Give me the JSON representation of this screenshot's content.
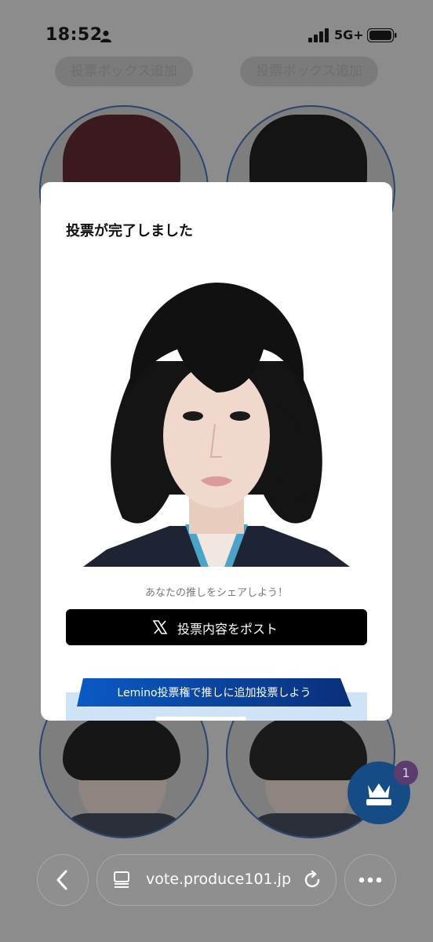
{
  "status_bar": {
    "time": "18:52",
    "network": "5G+"
  },
  "background": {
    "vote_box_label": "投票ボックス追加"
  },
  "modal": {
    "title": "投票が完了しました",
    "share_prompt": "あなたの推しをシェアしよう！",
    "post_button": "投票内容をポスト",
    "promo_banner": "Lemino投票権で推しに追加投票しよう"
  },
  "floating_button": {
    "badge_count": "1"
  },
  "browser": {
    "url": "vote.produce101.jp"
  },
  "colors": {
    "accent_blue": "#164c86",
    "banner_blue": "#0a4fa8",
    "badge_purple": "#5b3c6f"
  }
}
